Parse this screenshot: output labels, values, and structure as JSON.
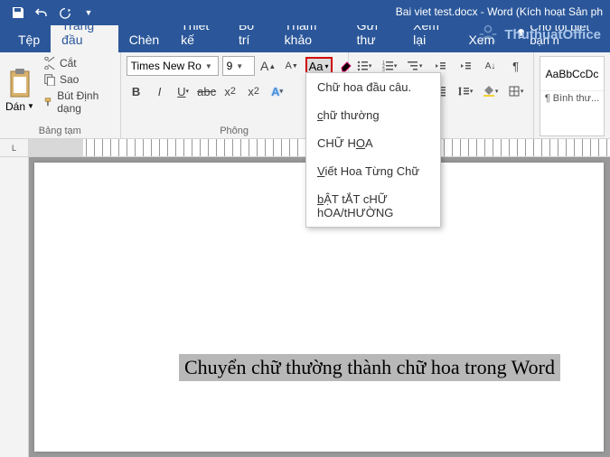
{
  "title": "Bai viet test.docx - Word (Kích hoạt Sản ph",
  "watermark": "ThuthuatOffice",
  "tabs": {
    "file": "Tệp",
    "home": "Trang đầu",
    "insert": "Chèn",
    "design": "Thiết kế",
    "layout": "Bố trí",
    "references": "Tham khảo",
    "mailings": "Gửi thư",
    "review": "Xem lại",
    "view": "Xem",
    "tellme": "Cho tôi biết bạn n"
  },
  "clipboard": {
    "paste": "Dán",
    "cut": "Cắt",
    "copy": "Sao",
    "format_painter": "Bút Định dạng",
    "label": "Bảng tạm"
  },
  "font": {
    "name": "Times New Ro",
    "size": "9",
    "label": "Phông"
  },
  "styles": {
    "preview": "AaBbCcDc",
    "name": "¶ Bình thư..."
  },
  "case_menu": {
    "sentence": "Chữ hoa đầu câu.",
    "lower": "chữ thường",
    "upper": "CHỮ HOA",
    "capitalize": "Viết Hoa Từng Chữ",
    "toggle": "bẬT tẮT cHỮ hOA/tHƯỜNG"
  },
  "document": {
    "selected_text": "Chuyển chữ thường thành chữ hoa trong Word"
  },
  "ruler_corner": "L"
}
